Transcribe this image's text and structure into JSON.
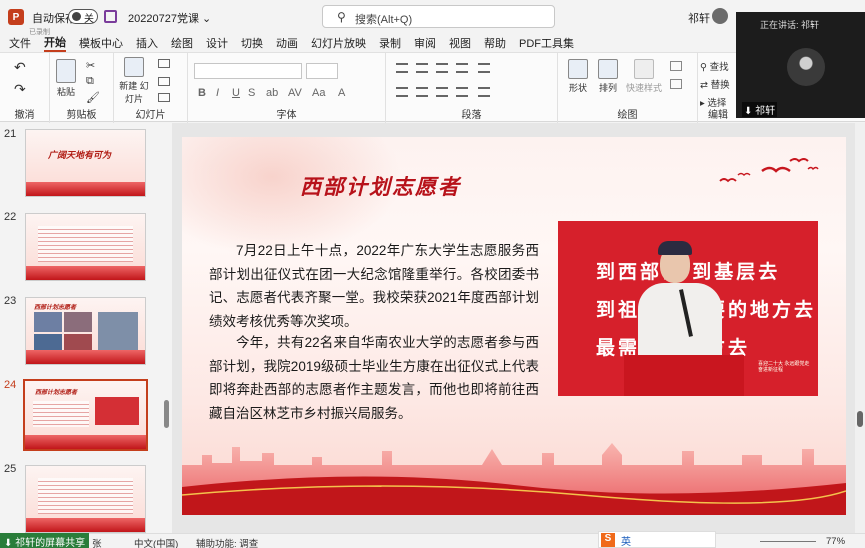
{
  "titlebar": {
    "autosave_label": "自动保存",
    "autosave_state": "关",
    "filename": "20220727党课",
    "search_placeholder": "搜索(Alt+Q)",
    "user": "祁轩",
    "recording_label": "已录制"
  },
  "menu": {
    "items": [
      "文件",
      "开始",
      "模板中心",
      "插入",
      "绘图",
      "设计",
      "切换",
      "动画",
      "幻灯片放映",
      "录制",
      "审阅",
      "视图",
      "帮助",
      "PDF工具集"
    ],
    "active": "开始"
  },
  "ribbon": {
    "groups": {
      "undo": "撤消",
      "clipboard": "剪贴板",
      "slides": "幻灯片",
      "font": "字体",
      "paragraph": "段落",
      "drawing": "绘图",
      "editing": "编辑"
    },
    "buttons": {
      "paste": "粘贴",
      "new_slide": "新建\n幻灯片",
      "shapes": "形状",
      "arrange": "排列",
      "quick_styles": "快速样式",
      "find": "查找",
      "replace": "替换",
      "select": "选择"
    }
  },
  "thumbnails": [
    {
      "num": "21",
      "title": "广阔天地有可为"
    },
    {
      "num": "22",
      "title": ""
    },
    {
      "num": "23",
      "title": "西部计划志愿者"
    },
    {
      "num": "24",
      "title": "西部计划志愿者"
    },
    {
      "num": "25",
      "title": ""
    }
  ],
  "current_slide_number": "24",
  "slide": {
    "title": "西部计划志愿者",
    "paragraph1": "7月22日上午十点，2022年广东大学生志愿服务西部计划出征仪式在团一大纪念馆隆重举行。各校团委书记、志愿者代表齐聚一堂。我校荣获2021年度西部计划绩效考核优秀等次奖项。",
    "paragraph2": "今年，共有22名来自华南农业大学的志愿者参与西部计划，我院2019级硕士毕业生方康在出征仪式上代表即将奔赴西部的志愿者作主题发言，而他也即将前往西藏自治区林芝市乡村振兴局服务。",
    "photo_banner": [
      "到西部去 到基层去",
      "到祖国最需要的地方去",
      "最需要的地方去"
    ],
    "photo_caption": "喜迎二十大 永远跟党走 奋进新征程"
  },
  "status": {
    "lang": "中文(中国)",
    "accessibility": "辅助功能: 调查",
    "zoom": "77%",
    "share": "祁轩的屏幕共享",
    "slide_count_fragment": "张",
    "ime": "英"
  },
  "video": {
    "caller_label": "正在讲话: 祁轩",
    "name": "祁轩"
  },
  "colors": {
    "accent": "#c43e1c",
    "slide_red": "#b7121a"
  }
}
